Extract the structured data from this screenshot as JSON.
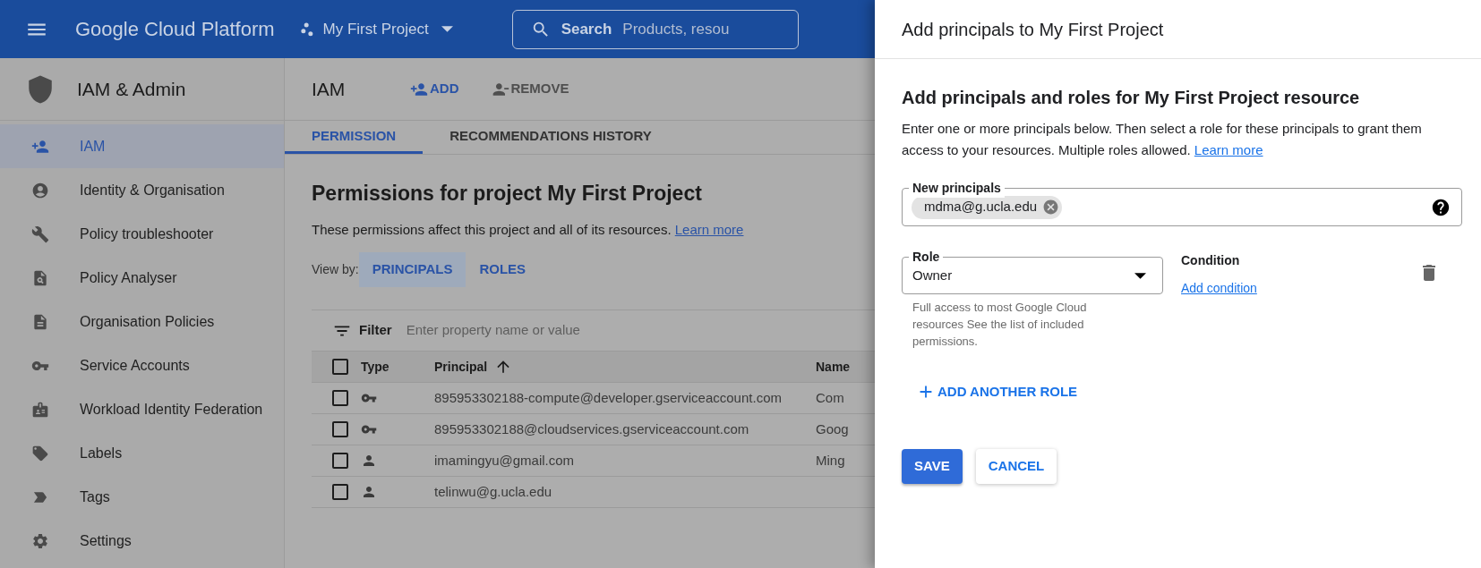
{
  "top_bar": {
    "product": "Google Cloud Platform",
    "project": "My First Project",
    "search": {
      "label": "Search",
      "placeholder": "Products, resou"
    }
  },
  "sidebar": {
    "title": "IAM & Admin",
    "items": [
      {
        "label": "IAM",
        "selected": true
      },
      {
        "label": "Identity & Organisation",
        "selected": false
      },
      {
        "label": "Policy troubleshooter",
        "selected": false
      },
      {
        "label": "Policy Analyser",
        "selected": false
      },
      {
        "label": "Organisation Policies",
        "selected": false
      },
      {
        "label": "Service Accounts",
        "selected": false
      },
      {
        "label": "Workload Identity Federation",
        "selected": false
      },
      {
        "label": "Labels",
        "selected": false
      },
      {
        "label": "Tags",
        "selected": false
      },
      {
        "label": "Settings",
        "selected": false
      }
    ]
  },
  "main": {
    "title": "IAM",
    "actions": [
      {
        "label": "ADD",
        "kind": "add"
      },
      {
        "label": "REMOVE",
        "kind": "remove"
      }
    ],
    "tabs": [
      {
        "label": "PERMISSION",
        "selected": true
      },
      {
        "label": "RECOMMENDATIONS HISTORY",
        "selected": false
      }
    ],
    "heading": "Permissions for project My First Project",
    "description": "These permissions affect this project and all of its resources.",
    "learn_more": "Learn more",
    "view_by": {
      "label": "View by:",
      "options": [
        {
          "label": "PRINCIPALS",
          "selected": true
        },
        {
          "label": "ROLES",
          "selected": false
        }
      ]
    },
    "filter": {
      "label": "Filter",
      "placeholder": "Enter property name or value"
    },
    "table": {
      "columns": [
        "Type",
        "Principal",
        "Name"
      ],
      "all_checked": false,
      "rows": [
        {
          "kind": "service_account",
          "checked": false,
          "principal": "895953302188-compute@developer.gserviceaccount.com",
          "name": "Com"
        },
        {
          "kind": "service_account",
          "checked": false,
          "principal": "895953302188@cloudservices.gserviceaccount.com",
          "name": "Goog"
        },
        {
          "kind": "user",
          "checked": false,
          "principal": "imamingyu@gmail.com",
          "name": "Ming"
        },
        {
          "kind": "user",
          "checked": false,
          "principal": "telinwu@g.ucla.edu"
        }
      ]
    }
  },
  "panel": {
    "title": "Add principals to My First Project",
    "heading": "Add principals and roles for My First Project resource",
    "description": "Enter one or more principals below. Then select a role for these principals to grant them access to your resources. Multiple roles allowed.",
    "learn_more": "Learn more",
    "principals": {
      "label": "New principals",
      "chips": [
        "mdma@g.ucla.edu"
      ]
    },
    "role": {
      "label": "Role",
      "value": "Owner",
      "hint": "Full access to most Google Cloud resources See the list of included permissions."
    },
    "condition": {
      "label": "Condition",
      "link": "Add condition"
    },
    "add_role": "ADD ANOTHER ROLE",
    "buttons": [
      {
        "label": "SAVE",
        "kind": "primary"
      },
      {
        "label": "CANCEL",
        "kind": "secondary"
      }
    ]
  }
}
